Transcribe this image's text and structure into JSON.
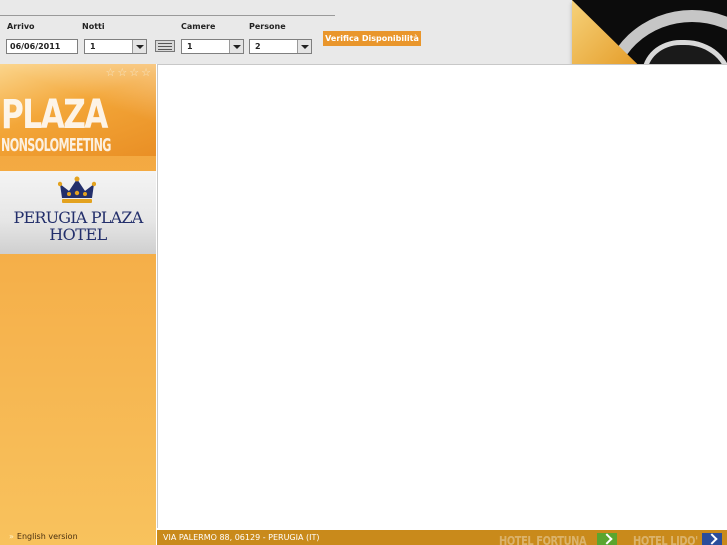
{
  "booking": {
    "arrival_label": "Arrivo",
    "arrival_value": "06/06/2011",
    "nights_label": "Notti",
    "nights_value": "1",
    "rooms_label": "Camere",
    "rooms_value": "1",
    "persons_label": "Persone",
    "persons_value": "2",
    "verify_label": "Verifica Disponibilità",
    "calendar_icon": "calendar-icon"
  },
  "sidebar": {
    "stars": [
      "☆",
      "☆",
      "☆",
      "☆"
    ],
    "brand_title": "PLAZA",
    "brand_subtitle": "NONSOLOMEETING",
    "hotel_name_line1": "PERUGIA PLAZA",
    "hotel_name_line2": "HOTEL",
    "english_bullet": "»",
    "english_link": "English version"
  },
  "footer": {
    "address": "VIA PALERMO 88, 06129 - PERUGIA (IT)",
    "partner1": "HOTEL FORTUNA",
    "partner2": "HOTEL LIDO'"
  },
  "colors": {
    "accent_orange": "#e9962c",
    "footer_gold": "#c98a1b",
    "hotel_navy": "#232f6b",
    "partner1_badge": "#5aa52f",
    "partner2_badge": "#2a4d9b"
  }
}
